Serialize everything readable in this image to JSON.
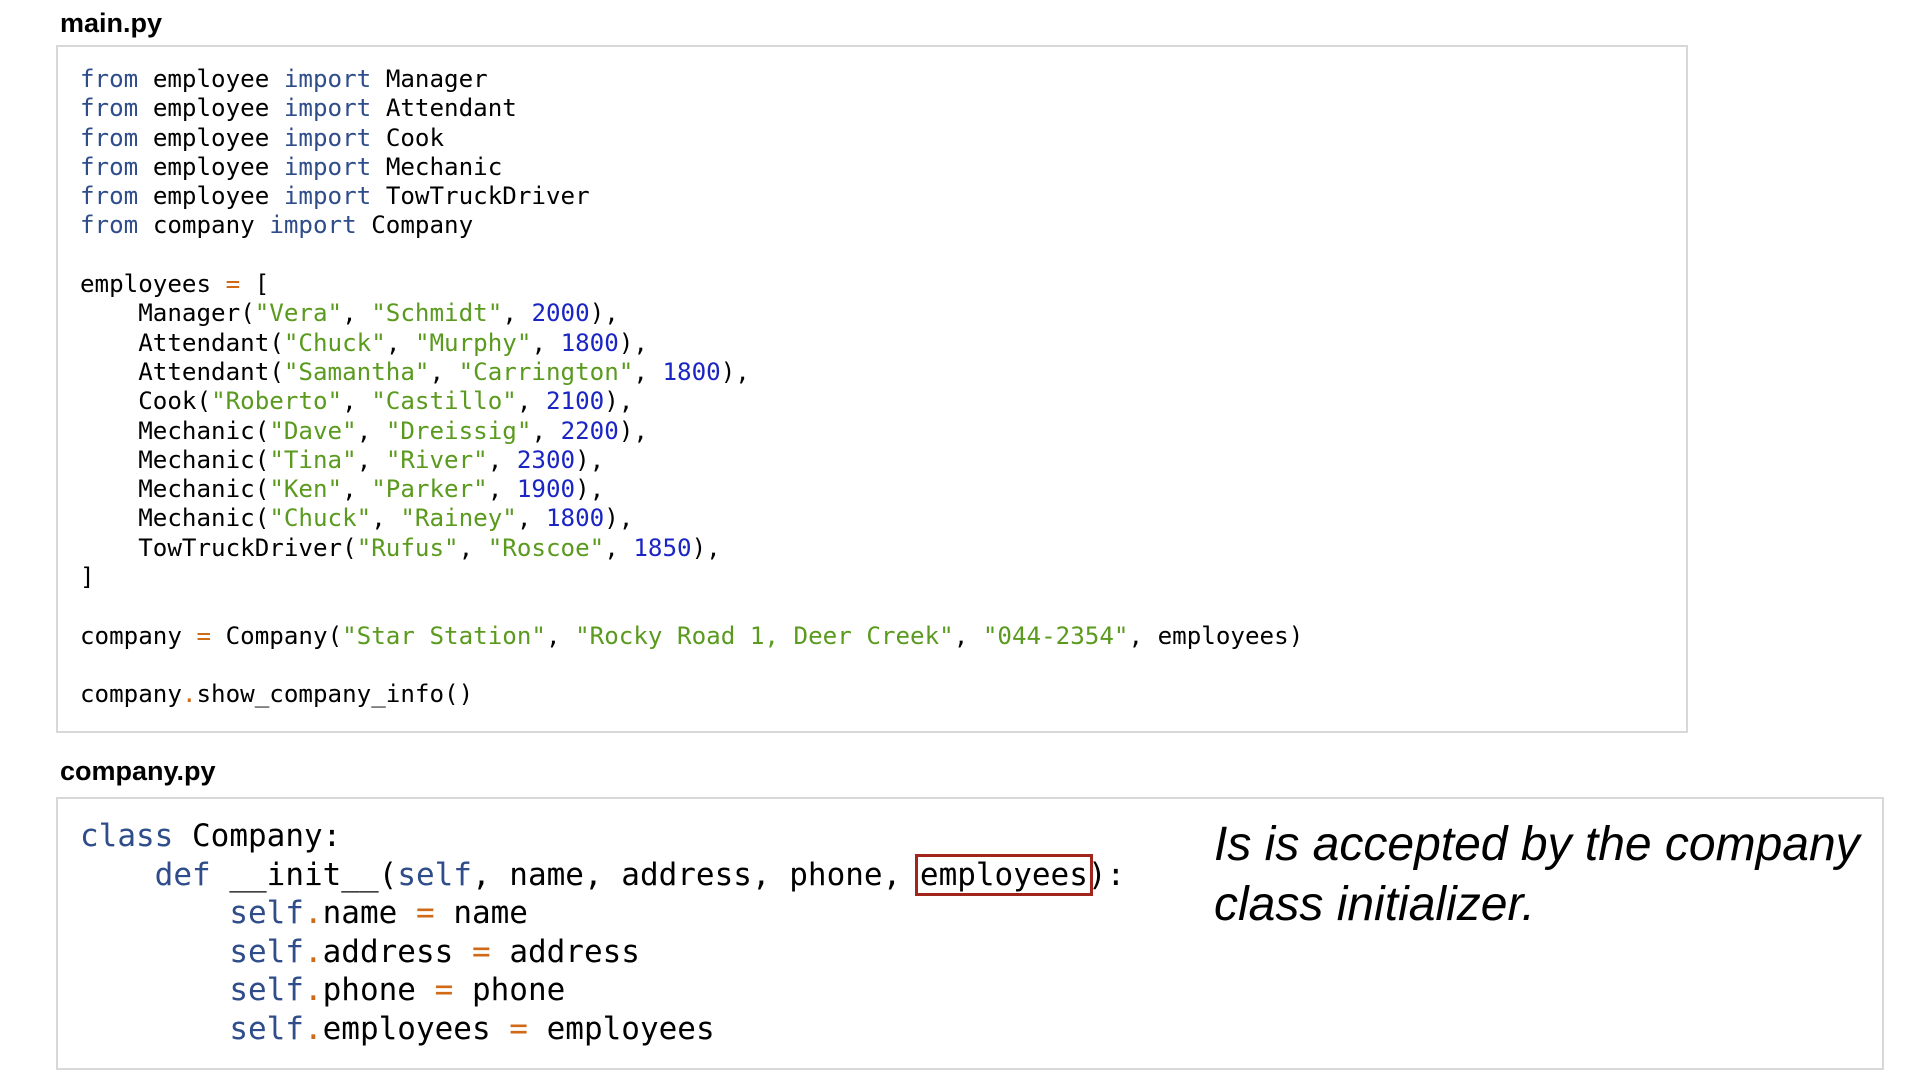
{
  "main_file": {
    "label": "main.py",
    "tokens": {
      "from": "from",
      "import": "import",
      "module_employee": "employee",
      "module_company": "company",
      "cls_manager": "Manager",
      "cls_attendant": "Attendant",
      "cls_cook": "Cook",
      "cls_mechanic": "Mechanic",
      "cls_towtruck": "TowTruckDriver",
      "cls_company": "Company",
      "employees_var": "employees",
      "eq": "=",
      "open_list": "[",
      "close_list": "]",
      "company_var": "company",
      "dot": ".",
      "method_call": "show_company_info()"
    },
    "employees": [
      {
        "cls": "Manager",
        "first": "\"Vera\"",
        "last": "\"Schmidt\"",
        "salary": "2000"
      },
      {
        "cls": "Attendant",
        "first": "\"Chuck\"",
        "last": "\"Murphy\"",
        "salary": "1800"
      },
      {
        "cls": "Attendant",
        "first": "\"Samantha\"",
        "last": "\"Carrington\"",
        "salary": "1800"
      },
      {
        "cls": "Cook",
        "first": "\"Roberto\"",
        "last": "\"Castillo\"",
        "salary": "2100"
      },
      {
        "cls": "Mechanic",
        "first": "\"Dave\"",
        "last": "\"Dreissig\"",
        "salary": "2200"
      },
      {
        "cls": "Mechanic",
        "first": "\"Tina\"",
        "last": "\"River\"",
        "salary": "2300"
      },
      {
        "cls": "Mechanic",
        "first": "\"Ken\"",
        "last": "\"Parker\"",
        "salary": "1900"
      },
      {
        "cls": "Mechanic",
        "first": "\"Chuck\"",
        "last": "\"Rainey\"",
        "salary": "1800"
      },
      {
        "cls": "TowTruckDriver",
        "first": "\"Rufus\"",
        "last": "\"Roscoe\"",
        "salary": "1850"
      }
    ],
    "company_args": {
      "name": "\"Star Station\"",
      "address": "\"Rocky Road 1, Deer Creek\"",
      "phone": "\"044-2354\"",
      "employees": "employees"
    }
  },
  "company_file": {
    "label": "company.py",
    "tokens": {
      "class_kw": "class",
      "class_name": "Company:",
      "def_kw": "def",
      "init_name": "__init__(",
      "self_kw": "self",
      "params_rest": ", name, address, phone, ",
      "highlight_param": "employees",
      "params_close": "):",
      "eq": "=",
      "dot": "."
    },
    "assignments": [
      {
        "attr": "name",
        "value": "name"
      },
      {
        "attr": "address",
        "value": "address"
      },
      {
        "attr": "phone",
        "value": "phone"
      },
      {
        "attr": "employees",
        "value": "employees"
      }
    ]
  },
  "annotation": "Is is accepted by the company class initializer."
}
